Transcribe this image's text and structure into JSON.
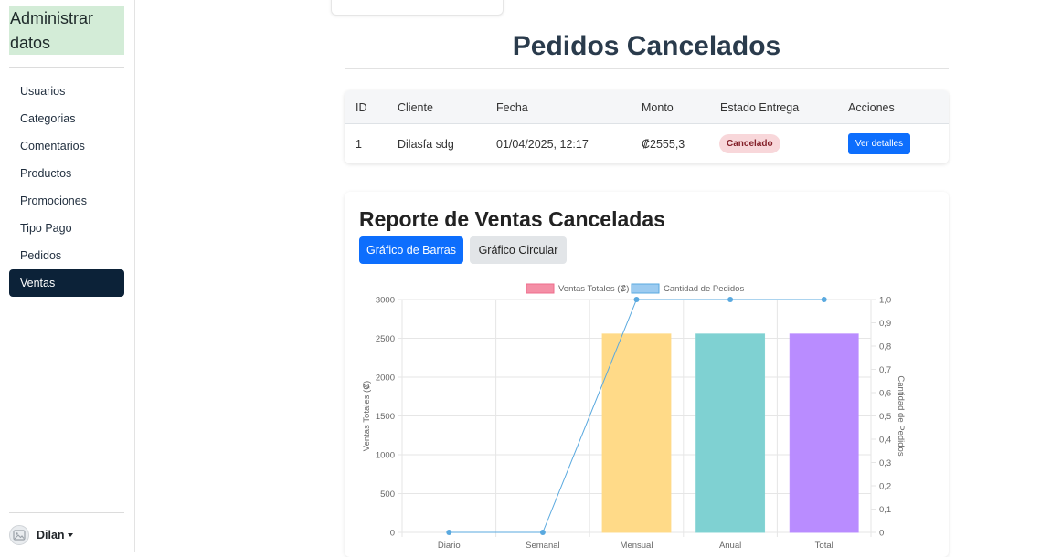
{
  "sidebar": {
    "brand": "Administrar datos",
    "items": [
      {
        "label": "Usuarios",
        "active": false
      },
      {
        "label": "Categorias",
        "active": false
      },
      {
        "label": "Comentarios",
        "active": false
      },
      {
        "label": "Productos",
        "active": false
      },
      {
        "label": "Promociones",
        "active": false
      },
      {
        "label": "Tipo Pago",
        "active": false
      },
      {
        "label": "Pedidos",
        "active": false
      },
      {
        "label": "Ventas",
        "active": true
      }
    ],
    "user": {
      "name": "Dilan",
      "icon": "avatar-icon"
    }
  },
  "page": {
    "title": "Pedidos Cancelados"
  },
  "orders": {
    "headers": [
      "ID",
      "Cliente",
      "Fecha",
      "Monto",
      "Estado Entrega",
      "Acciones"
    ],
    "rows": [
      {
        "id": "1",
        "cliente": "Dilasfa sdg",
        "fecha": "01/04/2025, 12:17",
        "monto": "₡2555,3",
        "estado": "Cancelado",
        "accion": "Ver detalles"
      }
    ]
  },
  "report": {
    "title": "Reporte de Ventas Canceladas",
    "bar_button": "Gráfico de Barras",
    "pie_button": "Gráfico Circular"
  },
  "colors": {
    "accent": "#0d6efd",
    "sidebar_active": "#0c2238",
    "brand_bg": "#d3ecd7",
    "bar_colors": [
      "#ffda88",
      "#7fd1d2",
      "#b98cff"
    ],
    "line": "#5aa9df",
    "legend_sales": "#f48fa6",
    "legend_orders": "#9ccbf0"
  },
  "chart_data": {
    "type": "bar",
    "categories": [
      "Diario",
      "Semanal",
      "Mensual",
      "Anual",
      "Total"
    ],
    "series": [
      {
        "name": "Ventas Totales (₡)",
        "type": "bar",
        "axis": "left",
        "values": [
          0,
          0,
          2555.3,
          2555.3,
          2555.3
        ]
      },
      {
        "name": "Cantidad de Pedidos",
        "type": "line",
        "axis": "right",
        "values": [
          0,
          0,
          1,
          1,
          1
        ]
      }
    ],
    "ylabel": "Ventas Totales (₡)",
    "y2label": "Cantidad de Pedidos",
    "ylim": [
      0,
      3000
    ],
    "y2lim": [
      0,
      1
    ],
    "yticks": [
      "0",
      "500",
      "1000",
      "1500",
      "2000",
      "2500",
      "3000"
    ],
    "y2ticks": [
      "0",
      "0,1",
      "0,2",
      "0,3",
      "0,4",
      "0,5",
      "0,6",
      "0,7",
      "0,8",
      "0,9",
      "1,0"
    ],
    "grid": true,
    "legend": "top-center"
  }
}
